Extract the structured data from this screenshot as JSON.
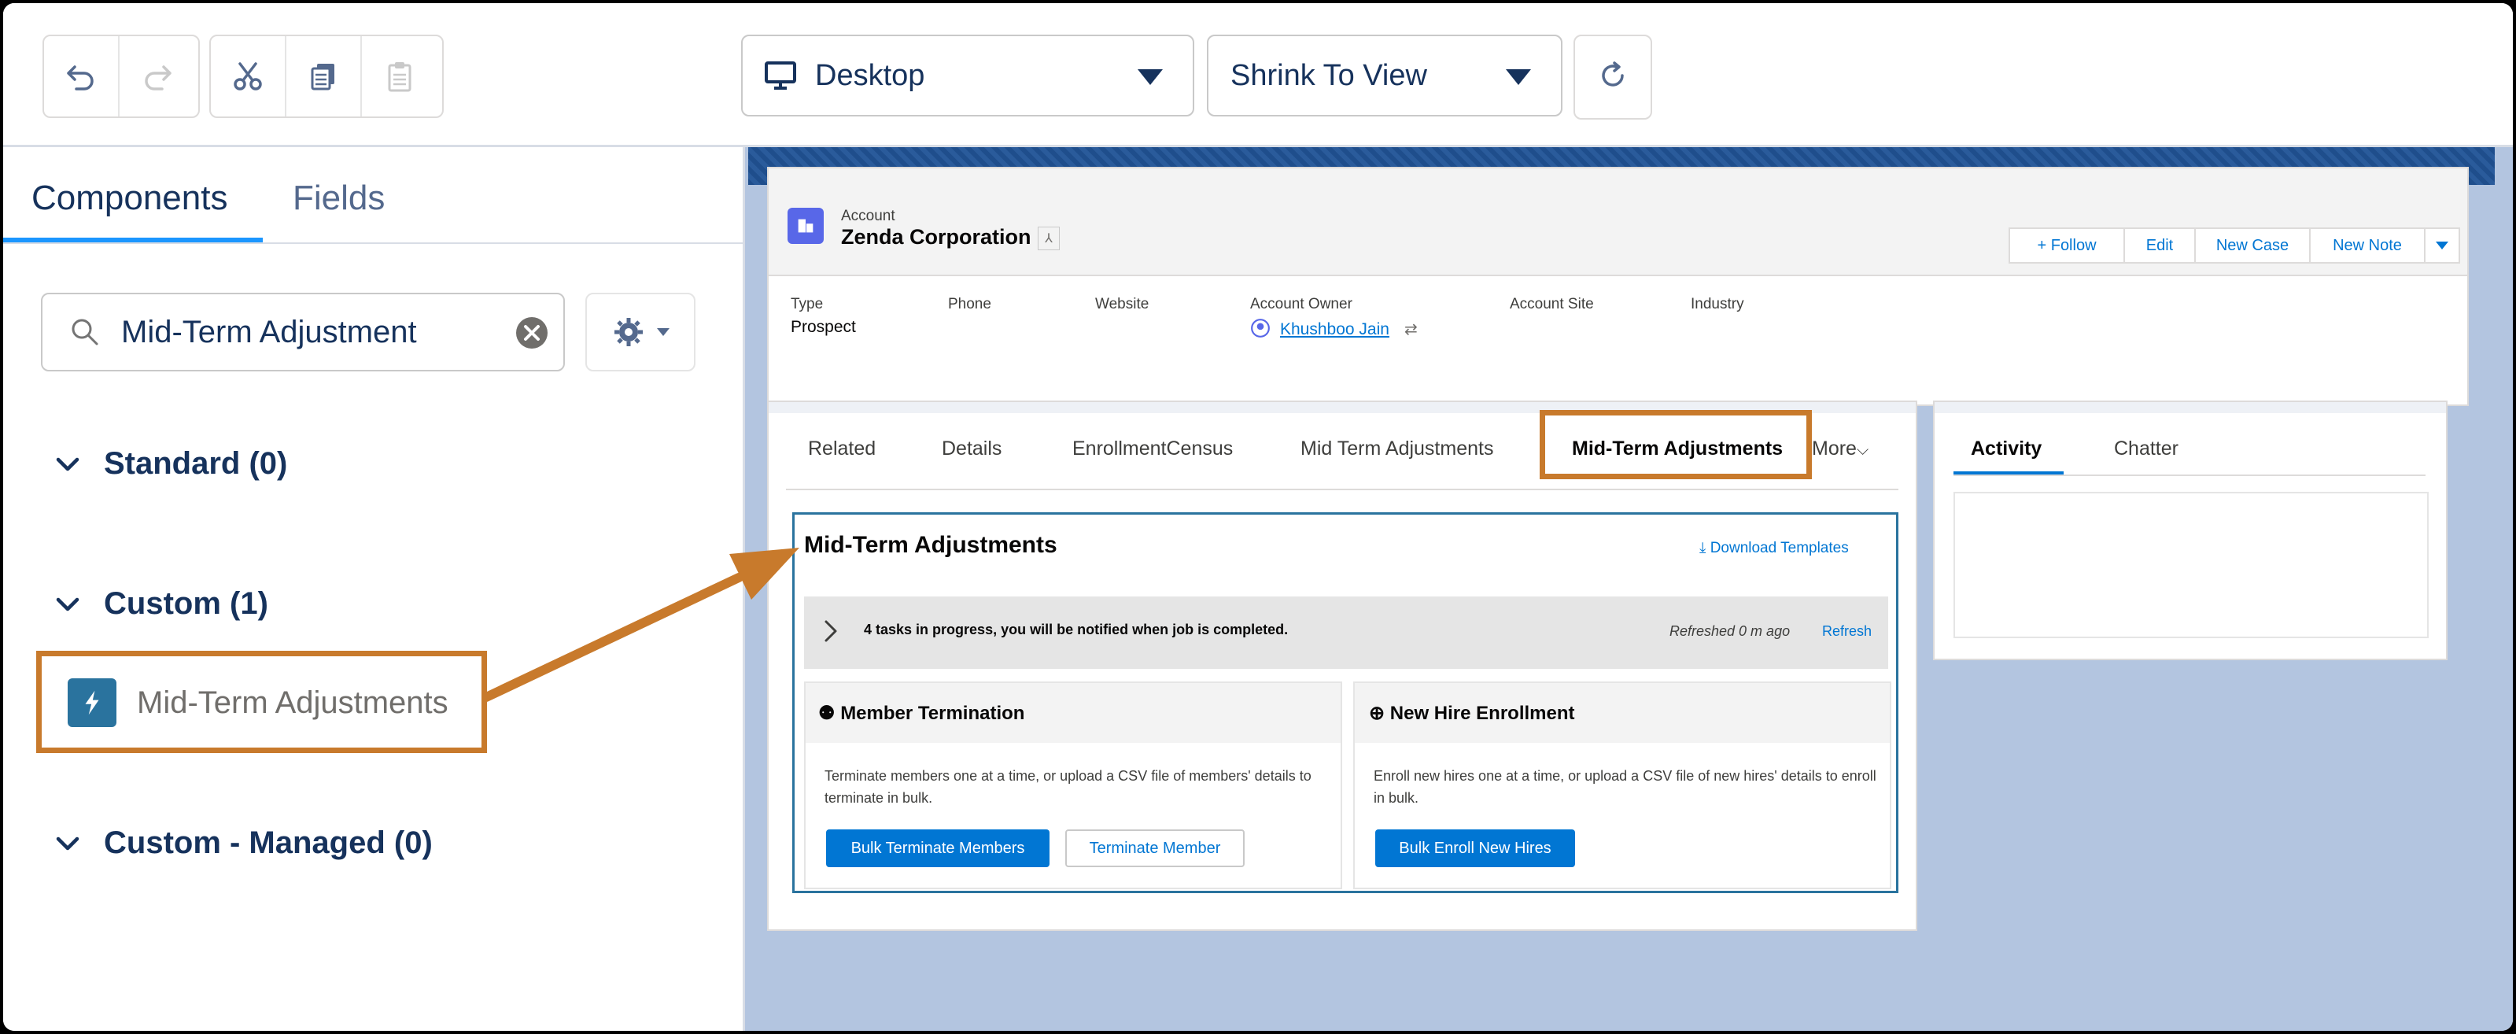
{
  "toolbar": {
    "device_label": "Desktop",
    "view_label": "Shrink To View"
  },
  "left_panel": {
    "tabs": [
      "Components",
      "Fields"
    ],
    "search_value": "Mid-Term Adjustment",
    "sections": [
      {
        "label": "Standard (0)"
      },
      {
        "label": "Custom (1)"
      },
      {
        "label": "Custom - Managed (0)"
      }
    ],
    "component_item": "Mid-Term Adjustments"
  },
  "record": {
    "object_label": "Account",
    "name": "Zenda Corporation",
    "actions": [
      "+ Follow",
      "Edit",
      "New Case",
      "New Note"
    ],
    "fields": [
      {
        "label": "Type",
        "value": "Prospect"
      },
      {
        "label": "Phone",
        "value": ""
      },
      {
        "label": "Website",
        "value": ""
      },
      {
        "label": "Account Owner",
        "value": "Khushboo Jain"
      },
      {
        "label": "Account Site",
        "value": ""
      },
      {
        "label": "Industry",
        "value": ""
      }
    ]
  },
  "tabs": [
    "Related",
    "Details",
    "EnrollmentCensus",
    "Mid Term Adjustments",
    "Mid-Term Adjustments",
    "More"
  ],
  "side_tabs": [
    "Activity",
    "Chatter"
  ],
  "component": {
    "title": "Mid-Term Adjustments",
    "download_link": "Download Templates",
    "banner_text": "4 tasks in progress, you will be notified when job is completed.",
    "refreshed_text": "Refreshed 0 m ago",
    "refresh_link": "Refresh",
    "member_termination": {
      "title": "Member Termination",
      "description": "Terminate members one at a time, or upload a CSV file of members' details to terminate in bulk.",
      "primary_button": "Bulk Terminate Members",
      "secondary_button": "Terminate Member"
    },
    "new_hire": {
      "title": "New Hire Enrollment",
      "description": "Enroll new hires one at a time, or upload a CSV file of new hires' details to enroll in bulk.",
      "primary_button": "Bulk Enroll New Hires"
    }
  },
  "colors": {
    "highlight": "#c87a2c",
    "brand_blue": "#0176d3",
    "canvas_bg": "#b3c5e0"
  }
}
